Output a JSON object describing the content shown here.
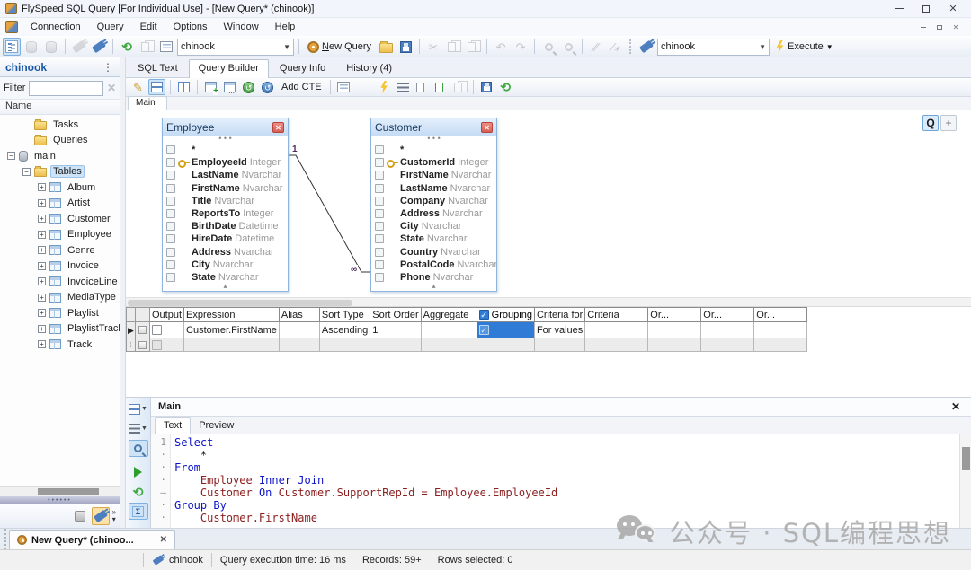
{
  "window": {
    "title": "FlySpeed SQL Query  [For Individual Use] - [New Query* (chinook)]"
  },
  "menu": {
    "items": [
      "Connection",
      "Query",
      "Edit",
      "Options",
      "Window",
      "Help"
    ]
  },
  "toolbar": {
    "connection_combo": "chinook",
    "new_query_label": "New Query",
    "query_combo": "chinook",
    "execute_label": "Execute"
  },
  "sidebar": {
    "title": "chinook",
    "filter_label": "Filter",
    "filter_value": "",
    "name_header": "Name",
    "tree": [
      {
        "label": "Tasks",
        "icon": "folder",
        "level": 1,
        "expander": ""
      },
      {
        "label": "Queries",
        "icon": "folder",
        "level": 1,
        "expander": ""
      },
      {
        "label": "main",
        "icon": "db",
        "level": 0,
        "expander": "minus"
      },
      {
        "label": "Tables",
        "icon": "folder",
        "level": 1,
        "expander": "minus",
        "selected": true
      },
      {
        "label": "Album",
        "icon": "table",
        "level": 2,
        "expander": "plus"
      },
      {
        "label": "Artist",
        "icon": "table",
        "level": 2,
        "expander": "plus"
      },
      {
        "label": "Customer",
        "icon": "table",
        "level": 2,
        "expander": "plus"
      },
      {
        "label": "Employee",
        "icon": "table",
        "level": 2,
        "expander": "plus"
      },
      {
        "label": "Genre",
        "icon": "table",
        "level": 2,
        "expander": "plus"
      },
      {
        "label": "Invoice",
        "icon": "table",
        "level": 2,
        "expander": "plus"
      },
      {
        "label": "InvoiceLine",
        "icon": "table",
        "level": 2,
        "expander": "plus"
      },
      {
        "label": "MediaType",
        "icon": "table",
        "level": 2,
        "expander": "plus"
      },
      {
        "label": "Playlist",
        "icon": "table",
        "level": 2,
        "expander": "plus"
      },
      {
        "label": "PlaylistTrack",
        "icon": "table",
        "level": 2,
        "expander": "plus"
      },
      {
        "label": "Track",
        "icon": "table",
        "level": 2,
        "expander": "plus"
      }
    ]
  },
  "tabs": {
    "items": [
      {
        "label": "SQL Text",
        "active": false
      },
      {
        "label": "Query Builder",
        "active": true
      },
      {
        "label": "Query Info",
        "active": false
      },
      {
        "label": "History (4)",
        "active": false
      }
    ]
  },
  "builder_toolbar": {
    "add_cte_label": "Add CTE"
  },
  "canvas": {
    "union_tab": "Main",
    "q_button": "Q",
    "add_union_button": "+",
    "join": {
      "one_label": "1",
      "many_label": "∞"
    },
    "tables": [
      {
        "name": "Employee",
        "fields": [
          {
            "name": "*",
            "type": ""
          },
          {
            "name": "EmployeeId",
            "type": "Integer",
            "key": true
          },
          {
            "name": "LastName",
            "type": "Nvarchar"
          },
          {
            "name": "FirstName",
            "type": "Nvarchar"
          },
          {
            "name": "Title",
            "type": "Nvarchar"
          },
          {
            "name": "ReportsTo",
            "type": "Integer"
          },
          {
            "name": "BirthDate",
            "type": "Datetime"
          },
          {
            "name": "HireDate",
            "type": "Datetime"
          },
          {
            "name": "Address",
            "type": "Nvarchar"
          },
          {
            "name": "City",
            "type": "Nvarchar"
          },
          {
            "name": "State",
            "type": "Nvarchar"
          }
        ]
      },
      {
        "name": "Customer",
        "fields": [
          {
            "name": "*",
            "type": ""
          },
          {
            "name": "CustomerId",
            "type": "Integer",
            "key": true
          },
          {
            "name": "FirstName",
            "type": "Nvarchar"
          },
          {
            "name": "LastName",
            "type": "Nvarchar"
          },
          {
            "name": "Company",
            "type": "Nvarchar"
          },
          {
            "name": "Address",
            "type": "Nvarchar"
          },
          {
            "name": "City",
            "type": "Nvarchar"
          },
          {
            "name": "State",
            "type": "Nvarchar"
          },
          {
            "name": "Country",
            "type": "Nvarchar"
          },
          {
            "name": "PostalCode",
            "type": "Nvarchar"
          },
          {
            "name": "Phone",
            "type": "Nvarchar"
          }
        ]
      }
    ]
  },
  "grid": {
    "columns": [
      "",
      "",
      "Output",
      "Expression",
      "Alias",
      "Sort Type",
      "Sort Order",
      "Aggregate",
      "Grouping",
      "Criteria for",
      "Criteria",
      "Or...",
      "Or...",
      "Or..."
    ],
    "rows": [
      {
        "output_checked": false,
        "expression": "Customer.FirstName",
        "alias": "",
        "sort_type": "Ascending",
        "sort_order": "1",
        "aggregate": "",
        "grouping_checked": true,
        "criteria_for": "For values",
        "criteria": "",
        "or_1": "",
        "or_2": "",
        "or_3": ""
      }
    ]
  },
  "sql_panel": {
    "header": "Main",
    "tabs": [
      {
        "label": "Text",
        "active": true
      },
      {
        "label": "Preview",
        "active": false
      }
    ],
    "lines": [
      {
        "num": "1",
        "tokens": [
          {
            "c": "kw",
            "t": "Select"
          }
        ]
      },
      {
        "num": "·",
        "tokens": [
          {
            "c": "pl",
            "t": "    *"
          }
        ]
      },
      {
        "num": "·",
        "tokens": [
          {
            "c": "kw",
            "t": "From"
          }
        ]
      },
      {
        "num": "·",
        "tokens": [
          {
            "c": "pl",
            "t": "    "
          },
          {
            "c": "id",
            "t": "Employee "
          },
          {
            "c": "kw",
            "t": "Inner Join"
          }
        ]
      },
      {
        "num": "–",
        "tokens": [
          {
            "c": "pl",
            "t": "    "
          },
          {
            "c": "id",
            "t": "Customer "
          },
          {
            "c": "kw",
            "t": "On"
          },
          {
            "c": "id",
            "t": " Customer.SupportRepId = Employee.EmployeeId"
          }
        ]
      },
      {
        "num": "·",
        "tokens": [
          {
            "c": "kw",
            "t": "Group By"
          }
        ]
      },
      {
        "num": "·",
        "tokens": [
          {
            "c": "pl",
            "t": "    "
          },
          {
            "c": "id",
            "t": "Customer.FirstName"
          }
        ]
      }
    ]
  },
  "bottom": {
    "doc_tab": "New Query* (chinoo...",
    "status_connection": "chinook",
    "status_exec": "Query execution time: 16 ms",
    "status_records": "Records: 59+",
    "status_rows": "Rows selected: 0"
  },
  "watermark": {
    "text": "公众号 · SQL编程思想"
  },
  "colors": {
    "accent_blue": "#2f7bd6",
    "keyword_blue": "#0d14c8",
    "identifier_maroon": "#8b2020",
    "close_red": "#d95f55",
    "key_gold": "#d4a017"
  }
}
